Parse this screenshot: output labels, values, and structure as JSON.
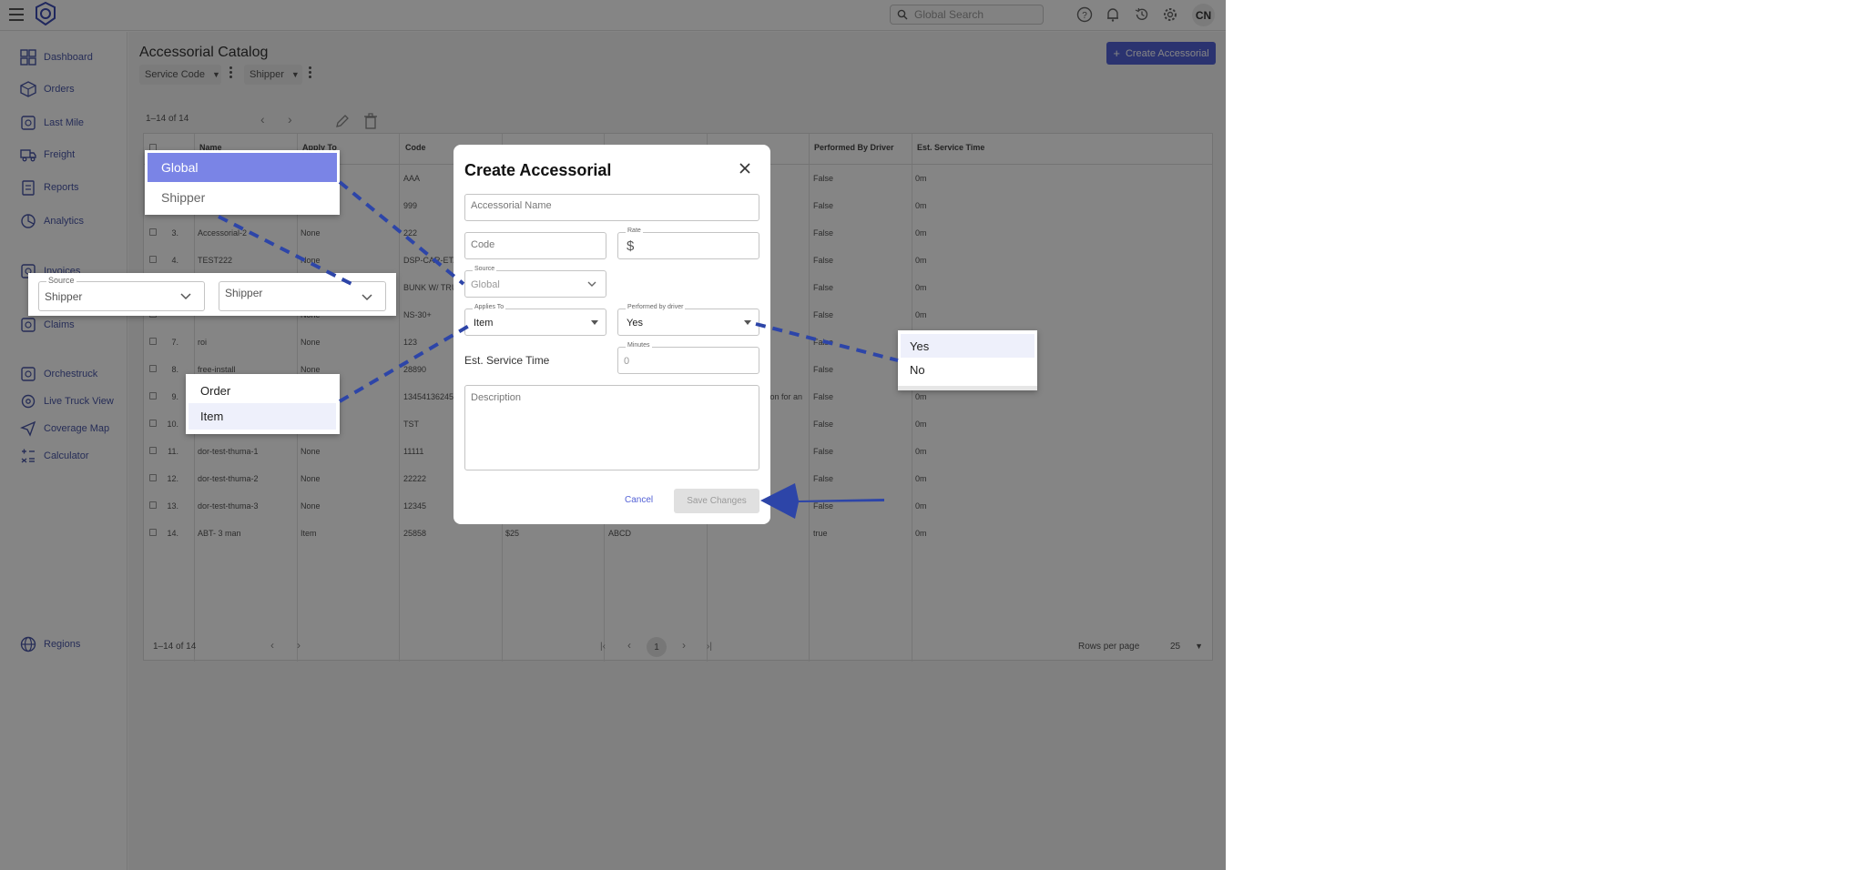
{
  "topbar": {
    "search_placeholder": "Global Search",
    "avatar_initials": "CN"
  },
  "sidebar": {
    "items": [
      {
        "label": "Dashboard",
        "icon": "dashboard-icon"
      },
      {
        "label": "Orders",
        "icon": "box-icon"
      },
      {
        "label": "Last Mile",
        "icon": "package-route-icon"
      },
      {
        "label": "Freight",
        "icon": "truck-icon"
      },
      {
        "label": "Reports",
        "icon": "report-icon"
      },
      {
        "label": "Analytics",
        "icon": "analytics-icon"
      },
      {
        "label": "Invoices",
        "icon": "invoice-icon"
      },
      {
        "label": "Claims",
        "icon": "claims-icon"
      },
      {
        "label": "Orchestruck",
        "icon": "orchestruck-icon"
      },
      {
        "label": "Live Truck View",
        "icon": "location-icon"
      },
      {
        "label": "Coverage Map",
        "icon": "send-icon"
      },
      {
        "label": "Calculator",
        "icon": "calculator-icon"
      },
      {
        "label": "Regions",
        "icon": "globe-icon"
      }
    ]
  },
  "page": {
    "title": "Accessorial Catalog",
    "filters": [
      "Service Code",
      "Shipper"
    ],
    "create_label": "Create Accessorial",
    "count_label": "1–14 of 14"
  },
  "table": {
    "headers": [
      "Name",
      "Apply To",
      "Code",
      "",
      "",
      "",
      "Performed By Driver",
      "Est. Service Time"
    ],
    "rows": [
      {
        "num": "",
        "name": "",
        "apply": "",
        "code": "AAA",
        "rate": "",
        "sc": "",
        "desc": "",
        "driver": "False",
        "time": "0m"
      },
      {
        "num": "",
        "name": "",
        "apply": "",
        "code": "999",
        "rate": "",
        "sc": "",
        "desc": "",
        "driver": "False",
        "time": "0m"
      },
      {
        "num": "3.",
        "name": "Accessorial-2",
        "apply": "None",
        "code": "222",
        "rate": "",
        "sc": "",
        "desc": "",
        "driver": "False",
        "time": "0m"
      },
      {
        "num": "4.",
        "name": "TEST222",
        "apply": "None",
        "code": "DSP-CAR-ETA",
        "rate": "",
        "sc": "",
        "desc": "",
        "driver": "False",
        "time": "0m"
      },
      {
        "num": "",
        "name": "",
        "apply": "",
        "code": "BUNK W/ TRU",
        "rate": "",
        "sc": "",
        "desc": "",
        "driver": "False",
        "time": "0m"
      },
      {
        "num": "",
        "name": "",
        "apply": "None",
        "code": "NS-30+",
        "rate": "",
        "sc": "",
        "desc": "",
        "driver": "False",
        "time": "0m"
      },
      {
        "num": "7.",
        "name": "roi",
        "apply": "None",
        "code": "123",
        "rate": "",
        "sc": "",
        "desc": "",
        "driver": "False",
        "time": "0m"
      },
      {
        "num": "8.",
        "name": "free-install",
        "apply": "None",
        "code": "28890",
        "rate": "",
        "sc": "",
        "desc": "",
        "driver": "False",
        "time": "0m"
      },
      {
        "num": "9.",
        "name": "",
        "apply": "",
        "code": "13454136245",
        "rate": "",
        "sc": "",
        "desc": "tion for an",
        "driver": "False",
        "time": "0m"
      },
      {
        "num": "10.",
        "name": "",
        "apply": "",
        "code": "TST",
        "rate": "",
        "sc": "",
        "desc": "",
        "driver": "False",
        "time": "0m"
      },
      {
        "num": "11.",
        "name": "dor-test-thuma-1",
        "apply": "None",
        "code": "11111",
        "rate": "",
        "sc": "",
        "desc": "",
        "driver": "False",
        "time": "0m"
      },
      {
        "num": "12.",
        "name": "dor-test-thuma-2",
        "apply": "None",
        "code": "22222",
        "rate": "",
        "sc": "",
        "desc": "",
        "driver": "False",
        "time": "0m"
      },
      {
        "num": "13.",
        "name": "dor-test-thuma-3",
        "apply": "None",
        "code": "12345",
        "rate": "",
        "sc": "",
        "desc": "",
        "driver": "False",
        "time": "0m"
      },
      {
        "num": "14.",
        "name": "ABT- 3 man",
        "apply": "Item",
        "code": "25858",
        "rate": "$25",
        "sc": "ABCD",
        "desc": "",
        "driver": "true",
        "time": "0m"
      }
    ]
  },
  "footer": {
    "count_label": "1–14 of 14",
    "current_page": "1",
    "rows_per_page_label": "Rows per page",
    "rows_per_page_value": "25"
  },
  "modal": {
    "title": "Create Accessorial",
    "name_placeholder": "Accessorial Name",
    "code_placeholder": "Code",
    "rate_label": "Rate",
    "rate_prefix": "$",
    "source_label": "Source",
    "source_value": "Global",
    "applies_to_label": "Applies To",
    "applies_to_value": "Item",
    "driver_label": "Performed by driver",
    "driver_value": "Yes",
    "est_service_time_label": "Est. Service Time",
    "minutes_label": "Minutes",
    "minutes_value": "0",
    "description_placeholder": "Description",
    "cancel_label": "Cancel",
    "save_label": "Save Changes"
  },
  "callouts": {
    "source_options": [
      "Global",
      "Shipper"
    ],
    "source_field": {
      "label": "Source",
      "value": "Shipper"
    },
    "shipper_field_value": "Shipper",
    "applies_to_options": [
      "Order",
      "Item"
    ],
    "driver_options": [
      "Yes",
      "No"
    ]
  },
  "colors": {
    "accent": "#5462d6",
    "arrow": "#2d45a8",
    "nav_text": "#4a57a8",
    "highlight": "#7a84e6"
  }
}
